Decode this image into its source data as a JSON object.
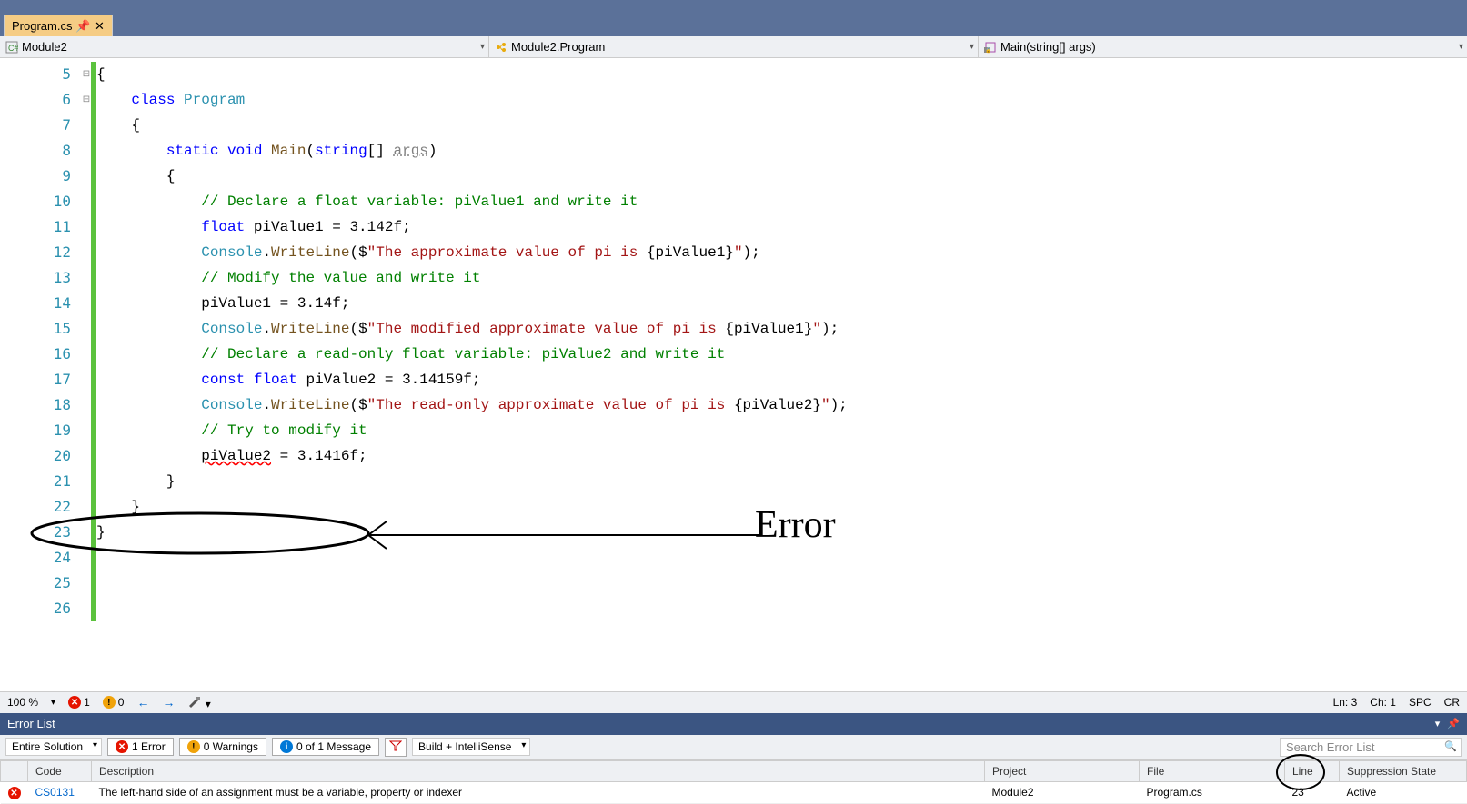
{
  "tab": {
    "filename": "Program.cs"
  },
  "breadcrumb": {
    "scope": "Module2",
    "class": "Module2.Program",
    "method": "Main(string[] args)"
  },
  "code_lines": [
    {
      "n": 5,
      "tokens": [
        {
          "t": "{",
          "c": ""
        }
      ]
    },
    {
      "n": 6,
      "tokens": [
        {
          "t": "    ",
          "c": ""
        },
        {
          "t": "class",
          "c": "kw"
        },
        {
          "t": " ",
          "c": ""
        },
        {
          "t": "Program",
          "c": "cls"
        }
      ]
    },
    {
      "n": 7,
      "tokens": [
        {
          "t": "    {",
          "c": ""
        }
      ]
    },
    {
      "n": 8,
      "tokens": [
        {
          "t": "        ",
          "c": ""
        },
        {
          "t": "static",
          "c": "kw"
        },
        {
          "t": " ",
          "c": ""
        },
        {
          "t": "void",
          "c": "kw"
        },
        {
          "t": " ",
          "c": ""
        },
        {
          "t": "Main",
          "c": "method"
        },
        {
          "t": "(",
          "c": ""
        },
        {
          "t": "string",
          "c": "kw"
        },
        {
          "t": "[] ",
          "c": ""
        },
        {
          "t": "args",
          "c": "param"
        },
        {
          "t": ")",
          "c": ""
        }
      ]
    },
    {
      "n": 9,
      "tokens": [
        {
          "t": "        {",
          "c": ""
        }
      ]
    },
    {
      "n": 10,
      "tokens": [
        {
          "t": "            ",
          "c": ""
        },
        {
          "t": "// Declare a float variable: piValue1 and write it",
          "c": "cmt"
        }
      ]
    },
    {
      "n": 11,
      "tokens": [
        {
          "t": "            ",
          "c": ""
        },
        {
          "t": "float",
          "c": "kw"
        },
        {
          "t": " piValue1 = 3.142f;",
          "c": ""
        }
      ]
    },
    {
      "n": 12,
      "tokens": [
        {
          "t": "            ",
          "c": ""
        },
        {
          "t": "Console",
          "c": "cls"
        },
        {
          "t": ".",
          "c": ""
        },
        {
          "t": "WriteLine",
          "c": "method"
        },
        {
          "t": "($",
          "c": ""
        },
        {
          "t": "\"The approximate value of pi is ",
          "c": "str"
        },
        {
          "t": "{piValue1}",
          "c": ""
        },
        {
          "t": "\"",
          "c": "str"
        },
        {
          "t": ");",
          "c": ""
        }
      ]
    },
    {
      "n": 13,
      "tokens": [
        {
          "t": "",
          "c": ""
        }
      ]
    },
    {
      "n": 14,
      "tokens": [
        {
          "t": "            ",
          "c": ""
        },
        {
          "t": "// Modify the value and write it",
          "c": "cmt"
        }
      ]
    },
    {
      "n": 15,
      "tokens": [
        {
          "t": "            piValue1 = 3.14f;",
          "c": ""
        }
      ]
    },
    {
      "n": 16,
      "tokens": [
        {
          "t": "            ",
          "c": ""
        },
        {
          "t": "Console",
          "c": "cls"
        },
        {
          "t": ".",
          "c": ""
        },
        {
          "t": "WriteLine",
          "c": "method"
        },
        {
          "t": "($",
          "c": ""
        },
        {
          "t": "\"The modified approximate value of pi is ",
          "c": "str"
        },
        {
          "t": "{piValue1}",
          "c": ""
        },
        {
          "t": "\"",
          "c": "str"
        },
        {
          "t": ");",
          "c": ""
        }
      ]
    },
    {
      "n": 17,
      "tokens": [
        {
          "t": "",
          "c": ""
        }
      ]
    },
    {
      "n": 18,
      "tokens": [
        {
          "t": "            ",
          "c": ""
        },
        {
          "t": "// Declare a read-only float variable: piValue2 and write it",
          "c": "cmt"
        }
      ]
    },
    {
      "n": 19,
      "tokens": [
        {
          "t": "            ",
          "c": ""
        },
        {
          "t": "const",
          "c": "kw"
        },
        {
          "t": " ",
          "c": ""
        },
        {
          "t": "float",
          "c": "kw"
        },
        {
          "t": " piValue2 = 3.14159f;",
          "c": ""
        }
      ]
    },
    {
      "n": 20,
      "tokens": [
        {
          "t": "            ",
          "c": ""
        },
        {
          "t": "Console",
          "c": "cls"
        },
        {
          "t": ".",
          "c": ""
        },
        {
          "t": "WriteLine",
          "c": "method"
        },
        {
          "t": "($",
          "c": ""
        },
        {
          "t": "\"The read-only approximate value of pi is ",
          "c": "str"
        },
        {
          "t": "{piValue2}",
          "c": ""
        },
        {
          "t": "\"",
          "c": "str"
        },
        {
          "t": ");",
          "c": ""
        }
      ]
    },
    {
      "n": 21,
      "tokens": [
        {
          "t": "",
          "c": ""
        }
      ]
    },
    {
      "n": 22,
      "tokens": [
        {
          "t": "            ",
          "c": ""
        },
        {
          "t": "// Try to modify it",
          "c": "cmt"
        }
      ]
    },
    {
      "n": 23,
      "tokens": [
        {
          "t": "            ",
          "c": ""
        },
        {
          "t": "piValue2",
          "c": "underline-err"
        },
        {
          "t": " = 3.1416f;",
          "c": ""
        }
      ]
    },
    {
      "n": 24,
      "tokens": [
        {
          "t": "        }",
          "c": ""
        }
      ]
    },
    {
      "n": 25,
      "tokens": [
        {
          "t": "    }",
          "c": ""
        }
      ]
    },
    {
      "n": 26,
      "tokens": [
        {
          "t": "}",
          "c": ""
        }
      ]
    }
  ],
  "annotation_label": "Error",
  "editor_status": {
    "zoom": "100 %",
    "errors": "1",
    "warnings": "0",
    "line": "Ln: 3",
    "col": "Ch: 1",
    "ins": "SPC",
    "crlf": "CR"
  },
  "error_list": {
    "title": "Error List",
    "scope": "Entire Solution",
    "errors_label": "1 Error",
    "warnings_label": "0 Warnings",
    "messages_label": "0 of 1 Message",
    "build_label": "Build + IntelliSense",
    "search_placeholder": "Search Error List",
    "columns": [
      "",
      "Code",
      "Description",
      "Project",
      "File",
      "Line",
      "Suppression State"
    ],
    "rows": [
      {
        "code": "CS0131",
        "description": "The left-hand side of an assignment must be a variable, property or indexer",
        "project": "Module2",
        "file": "Program.cs",
        "line": "23",
        "state": "Active"
      }
    ]
  }
}
